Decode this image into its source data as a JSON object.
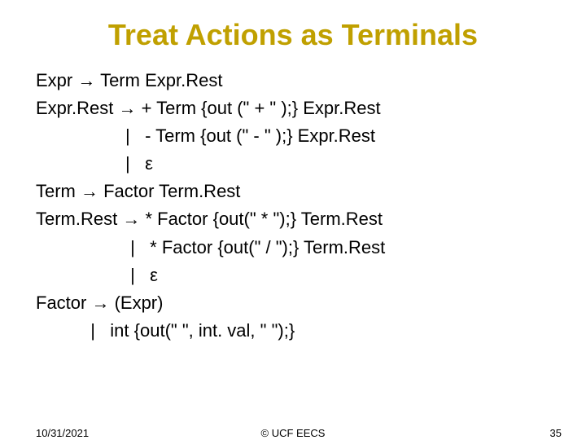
{
  "title": "Treat Actions as Terminals",
  "lines": [
    "Expr → Term Expr.Rest",
    "Expr.Rest → + Term {out (\" + \" );} Expr.Rest",
    "                  |   - Term {out (\" - \" );} Expr.Rest",
    "                  |   ε",
    "Term → Factor Term.Rest",
    "Term.Rest → * Factor {out(\" * \");} Term.Rest",
    "                   |   * Factor {out(\" / \");} Term.Rest",
    "                   |   ε",
    "Factor → (Expr)",
    "           |   int {out(\" \", int. val, \" \");}"
  ],
  "footer": {
    "date": "10/31/2021",
    "copyright": "© UCF EECS",
    "page": "35"
  }
}
